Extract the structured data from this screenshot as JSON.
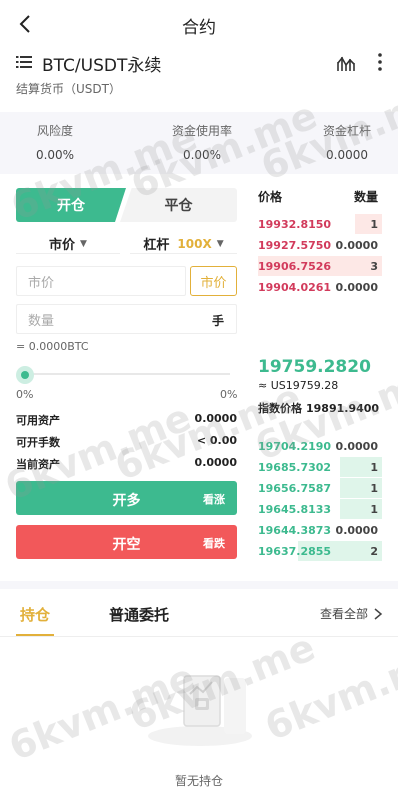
{
  "header": {
    "title": "合约"
  },
  "symbol": {
    "name": "BTC/USDT永续",
    "settle_label": "结算货币（USDT）"
  },
  "risk": [
    {
      "label": "风险度",
      "value": "0.00%"
    },
    {
      "label": "资金使用率",
      "value": "0.00%"
    },
    {
      "label": "资金杠杆",
      "value": "0.0000"
    }
  ],
  "order": {
    "tab_open": "开仓",
    "tab_close": "平仓",
    "type_select": "市价",
    "leverage_label": "杠杆",
    "leverage_value": "100X",
    "price_placeholder": "市价",
    "market_button": "市价",
    "qty_placeholder": "数量",
    "qty_unit": "手",
    "equal_text": "= 0.0000BTC",
    "slider_level": 0,
    "pct_left": "0%",
    "pct_right": "0%",
    "available_label": "可用资产",
    "available_value": "0.0000",
    "openable_label": "可开手数",
    "openable_value": "< 0.00",
    "current_label": "当前资产",
    "current_value": "0.0000",
    "long_label": "开多",
    "long_sub": "看涨",
    "short_label": "开空",
    "short_sub": "看跌"
  },
  "orderbook": {
    "price_header": "价格",
    "qty_header": "数量",
    "asks": [
      {
        "price": "19932.8150",
        "qty": "1",
        "fill": 0.22
      },
      {
        "price": "19927.5750",
        "qty": "0.0000",
        "fill": 0
      },
      {
        "price": "19906.7526",
        "qty": "3",
        "fill": 1.0
      },
      {
        "price": "19904.0261",
        "qty": "0.0000",
        "fill": 0
      }
    ],
    "last_price": "19759.2820",
    "approx": "≈ US19759.28",
    "index_label": "指数价格",
    "index_value": "19891.9400",
    "bids": [
      {
        "price": "19704.2190",
        "qty": "0.0000",
        "fill": 0
      },
      {
        "price": "19685.7302",
        "qty": "1",
        "fill": 0.34
      },
      {
        "price": "19656.7587",
        "qty": "1",
        "fill": 0.34
      },
      {
        "price": "19645.8133",
        "qty": "1",
        "fill": 0.34
      },
      {
        "price": "19644.3873",
        "qty": "0.0000",
        "fill": 0
      },
      {
        "price": "19637.2855",
        "qty": "2",
        "fill": 0.68
      }
    ]
  },
  "bottom_tabs": {
    "active": "持仓",
    "second": "普通委托",
    "view_all": "查看全部"
  },
  "empty": {
    "text": "暂无持仓"
  },
  "watermark": "6kvm.me",
  "colors": {
    "green": "#3dba8f",
    "red": "#f2585a",
    "gold": "#e2b03a",
    "ask_text": "#d23b5c"
  }
}
